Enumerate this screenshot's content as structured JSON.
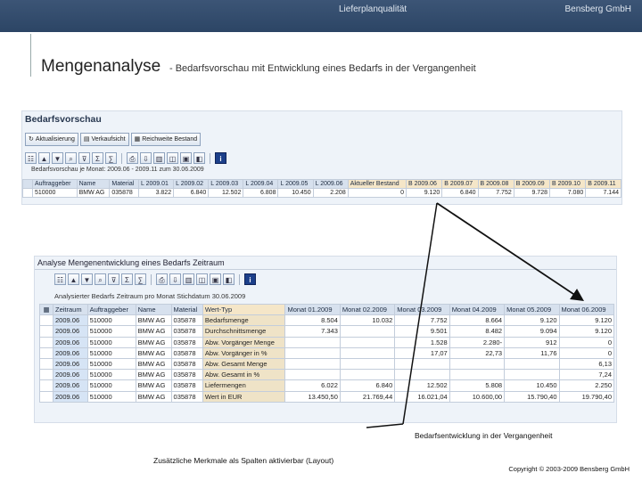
{
  "header": {
    "center": "Lieferplanqualität",
    "company": "Bensberg GmbH"
  },
  "slide": {
    "title": "Mengenanalyse",
    "subtitle": "- Bedarfsvorschau mit Entwicklung eines Bedarfs in der Vergangenheit"
  },
  "screen1": {
    "title": "Bedarfsvorschau",
    "toolbar": [
      "Aktualisierung",
      "Verkaufsicht",
      "Reichweite Bestand"
    ],
    "period": "Bedarfsvorschau je Monat: 2009.06 - 2009.11 zum 30.06.2009",
    "columns": [
      "Auftraggeber",
      "Name",
      "Material",
      "L 2009.01",
      "L 2009.02",
      "L 2009.03",
      "L 2009.04",
      "L 2009.05",
      "L 2009.06",
      "Aktueller Bestand",
      "B 2009.06",
      "B 2009.07",
      "B 2009.08",
      "B 2009.09",
      "B 2009.10",
      "B 2009.11"
    ],
    "row": [
      "510000",
      "BMW AG",
      "035878",
      "3.822",
      "6.840",
      "12.502",
      "6.808",
      "10.450",
      "2.208",
      "0",
      "9.120",
      "6.840",
      "7.752",
      "9.728",
      "7.080",
      "7.144"
    ]
  },
  "screen2": {
    "title": "Analyse Mengenentwicklung eines Bedarfs Zeitraum",
    "subheader": "Analysierter Bedarfs Zeitraum pro Monat Stichdatum 30.06.2009",
    "columns": [
      "Zeitraum",
      "Auftraggeber",
      "Name",
      "Material",
      "Wert-Typ",
      "Monat 01.2009",
      "Monat 02.2009",
      "Monat 03.2009",
      "Monat 04.2009",
      "Monat 05.2009",
      "Monat 06.2009"
    ],
    "rows": [
      [
        "2009.06",
        "510000",
        "BMW AG",
        "035878",
        "Bedarfsmenge",
        "8.504",
        "10.032",
        "7.752",
        "8.664",
        "9.120",
        "9.120"
      ],
      [
        "2009.06",
        "510000",
        "BMW AG",
        "035878",
        "Durchschnittsmenge",
        "7.343",
        "",
        "9.501",
        "8.482",
        "9.094",
        "9.120"
      ],
      [
        "2009.06",
        "510000",
        "BMW AG",
        "035878",
        "Abw. Vorgänger Menge",
        "",
        "",
        "1.528",
        "2.280-",
        "912",
        "456"
      ],
      [
        "2009.06",
        "510000",
        "BMW AG",
        "035878",
        "Abw. Vorgänger in %",
        "",
        "",
        "17,07",
        "22,73",
        "11,76",
        "5,26"
      ],
      [
        "2009.06",
        "510000",
        "BMW AG",
        "035878",
        "Abw. Gesamt Menge",
        "",
        "",
        "",
        "",
        "",
        ""
      ],
      [
        "2009.06",
        "510000",
        "BMW AG",
        "035878",
        "Abw. Gesamt in %",
        "",
        "",
        "",
        "",
        "",
        ""
      ],
      [
        "2009.06",
        "510000",
        "BMW AG",
        "035878",
        "Liefermengen",
        "6.022",
        "6.840",
        "12.502",
        "5.808",
        "10.450",
        "2.250"
      ],
      [
        "2009.06",
        "510000",
        "BMW AG",
        "035878",
        "Wert in EUR",
        "13.450,50",
        "21.769,44",
        "16.021,04",
        "10.600,00",
        "15.790,40",
        "19.790,40"
      ]
    ],
    "row5_last": "6,13",
    "row6_last": "7,24",
    "row3_last": "0",
    "row4_last": "0"
  },
  "captions": {
    "development": "Bedarfsentwicklung in der Vergangenheit",
    "layout_note": "Zusätzliche Merkmale als Spalten aktivierbar (Layout)",
    "copyright": "Copyright © 2003-2009 Bensberg GmbH"
  }
}
